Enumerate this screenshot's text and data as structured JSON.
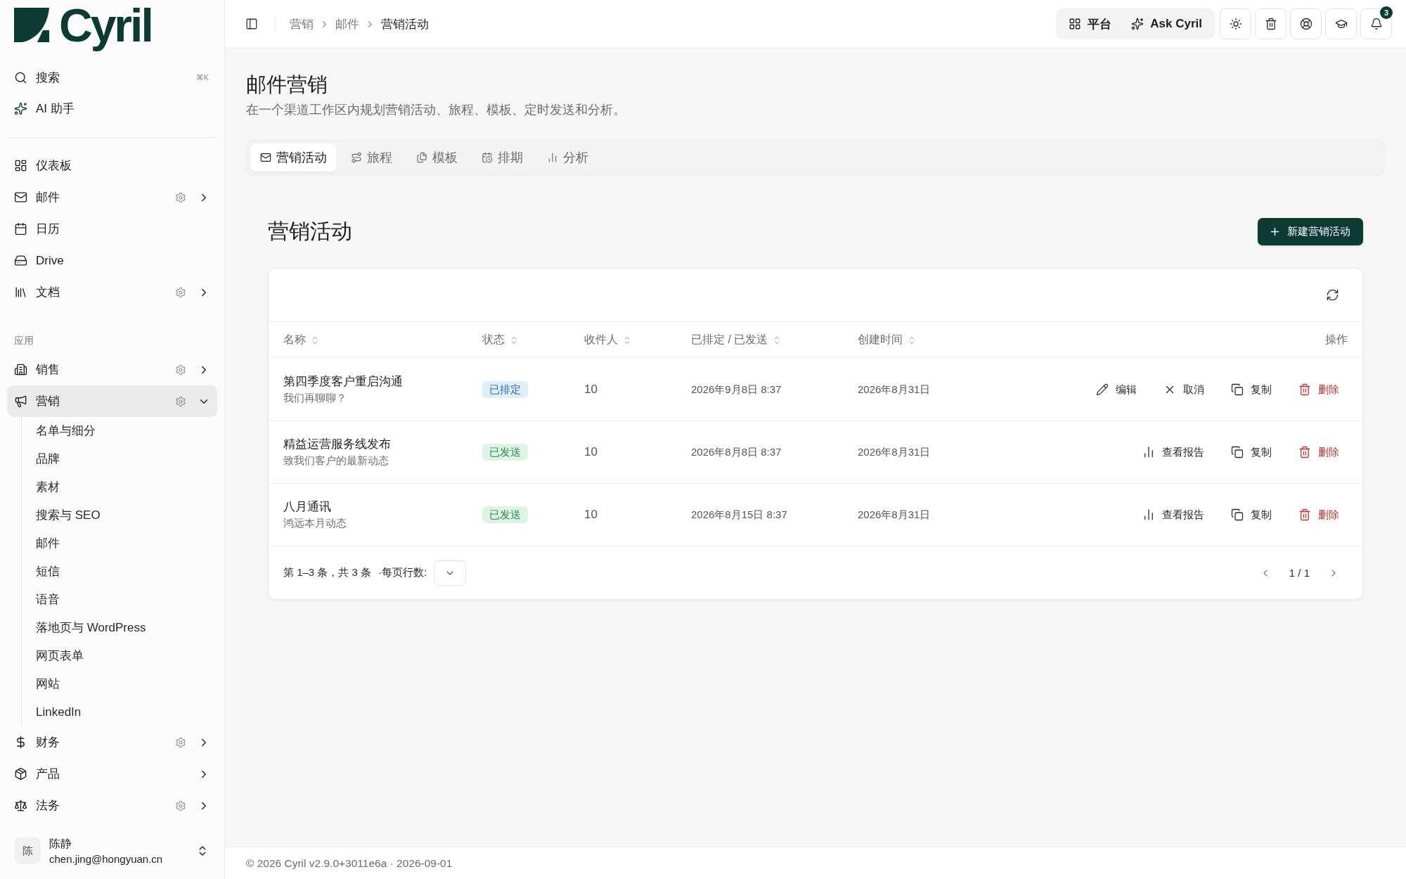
{
  "logo": {
    "text": "Cyril"
  },
  "sidebar": {
    "quick": [
      {
        "label": "搜索",
        "shortcut": "⌘K"
      },
      {
        "label": "AI 助手"
      }
    ],
    "nav": [
      {
        "label": "仪表板",
        "kind": "link",
        "settings": false,
        "selected": false
      },
      {
        "label": "邮件",
        "kind": "group",
        "settings": true,
        "expanded": false,
        "selected": false
      },
      {
        "label": "日历",
        "kind": "link",
        "settings": false,
        "selected": false
      },
      {
        "label": "Drive",
        "kind": "link",
        "settings": false,
        "selected": false
      },
      {
        "label": "文档",
        "kind": "group",
        "settings": true,
        "expanded": false,
        "selected": false
      }
    ],
    "apps_heading": "应用",
    "apps": [
      {
        "label": "销售",
        "kind": "group",
        "settings": true,
        "expanded": false,
        "selected": false
      },
      {
        "label": "营销",
        "kind": "group",
        "settings": true,
        "expanded": true,
        "selected": true,
        "children": [
          {
            "label": "名单与细分"
          },
          {
            "label": "品牌"
          },
          {
            "label": "素材"
          },
          {
            "label": "搜索与 SEO"
          },
          {
            "label": "邮件"
          },
          {
            "label": "短信"
          },
          {
            "label": "语音"
          },
          {
            "label": "落地页与 WordPress"
          },
          {
            "label": "网页表单"
          },
          {
            "label": "网站"
          },
          {
            "label": "LinkedIn"
          }
        ]
      },
      {
        "label": "财务",
        "kind": "group",
        "settings": true,
        "expanded": false,
        "selected": false
      },
      {
        "label": "产品",
        "kind": "group",
        "settings": false,
        "expanded": false,
        "selected": false
      },
      {
        "label": "法务",
        "kind": "group",
        "settings": true,
        "expanded": false,
        "selected": false
      }
    ],
    "user": {
      "avatar": "陈",
      "name": "陈静",
      "email": "chen.jing@hongyuan.cn"
    }
  },
  "topbar": {
    "breadcrumb": [
      {
        "label": "营销",
        "current": false
      },
      {
        "label": "邮件",
        "current": false
      },
      {
        "label": "营销活动",
        "current": true
      }
    ],
    "switcher": [
      {
        "label": "平台"
      },
      {
        "label": "Ask Cyril"
      }
    ],
    "notifications": {
      "count": "3"
    }
  },
  "page": {
    "title": "邮件营销",
    "subtitle": "在一个渠道工作区内规划营销活动、旅程、模板、定时发送和分析。"
  },
  "tabs": [
    {
      "label": "营销活动",
      "selected": true
    },
    {
      "label": "旅程",
      "selected": false
    },
    {
      "label": "模板",
      "selected": false
    },
    {
      "label": "排期",
      "selected": false
    },
    {
      "label": "分析",
      "selected": false
    }
  ],
  "section": {
    "title": "营销活动",
    "new_button": "新建营销活动"
  },
  "table": {
    "columns": [
      {
        "label": "名称",
        "sortable": true
      },
      {
        "label": "状态",
        "sortable": true
      },
      {
        "label": "收件人",
        "sortable": true
      },
      {
        "label": "已排定 / 已发送",
        "sortable": true
      },
      {
        "label": "创建时间",
        "sortable": true
      },
      {
        "label": "操作",
        "sortable": false
      }
    ],
    "rows": [
      {
        "name": "第四季度客户重启沟通",
        "subtitle": "我们再聊聊？",
        "status": {
          "label": "已排定",
          "kind": "scheduled"
        },
        "recipients": "10",
        "scheduled_sent": "2026年9月8日 8:37",
        "created": "2026年8月31日",
        "actions": [
          {
            "label": "编辑",
            "kind": "edit"
          },
          {
            "label": "取消",
            "kind": "cancel"
          },
          {
            "label": "复制",
            "kind": "copy"
          },
          {
            "label": "删除",
            "kind": "delete"
          }
        ]
      },
      {
        "name": "精益运营服务线发布",
        "subtitle": "致我们客户的最新动态",
        "status": {
          "label": "已发送",
          "kind": "sent"
        },
        "recipients": "10",
        "scheduled_sent": "2026年8月8日 8:37",
        "created": "2026年8月31日",
        "actions": [
          {
            "label": "查看报告",
            "kind": "report"
          },
          {
            "label": "复制",
            "kind": "copy"
          },
          {
            "label": "删除",
            "kind": "delete"
          }
        ]
      },
      {
        "name": "八月通讯",
        "subtitle": "鸿远本月动态",
        "status": {
          "label": "已发送",
          "kind": "sent"
        },
        "recipients": "10",
        "scheduled_sent": "2026年8月15日 8:37",
        "created": "2026年8月31日",
        "actions": [
          {
            "label": "查看报告",
            "kind": "report"
          },
          {
            "label": "复制",
            "kind": "copy"
          },
          {
            "label": "删除",
            "kind": "delete"
          }
        ]
      }
    ],
    "footer": {
      "range": "第 1–3 条，共 3 条",
      "rows_per_page_label": "·每页行数:",
      "page": "1 / 1"
    }
  },
  "footer": {
    "text": "© 2026 Cyril v2.9.0+3011e6a · 2026-09-01"
  }
}
